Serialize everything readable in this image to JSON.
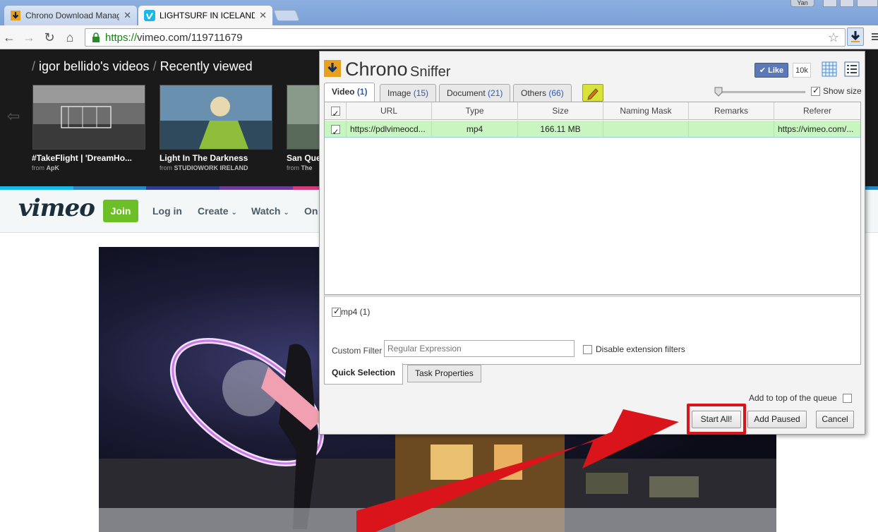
{
  "browser": {
    "tabs": [
      {
        "title": "Chrono Download Manag",
        "active": false
      },
      {
        "title": "LIGHTSURF IN ICELAND o",
        "active": true
      }
    ],
    "user_badge": "Yan",
    "address": {
      "protocol": "https://",
      "host": "vimeo.com/119711679"
    }
  },
  "vimeo": {
    "breadcrumb": {
      "owner": "igor bellido's videos",
      "section": "Recently viewed",
      "slash": "/"
    },
    "thumbnails": [
      {
        "title": "#TakeFlight | 'DreamHo...",
        "from": "from",
        "author": "ApK"
      },
      {
        "title": "Light In The Darkness",
        "from": "from",
        "author": "STUDIOWORK IRELAND"
      },
      {
        "title": "San Que",
        "from": "from",
        "author": "The"
      }
    ],
    "logo": "vimeo",
    "join": "Join",
    "nav": {
      "login": "Log in",
      "create": "Create",
      "watch": "Watch",
      "on": "On"
    }
  },
  "sniffer": {
    "title": "Chrono",
    "subtitle": "Sniffer",
    "like_label": "Like",
    "like_count": "10k",
    "show_size": "Show size",
    "tabs": [
      {
        "label": "Video",
        "count": "(1)"
      },
      {
        "label": "Image",
        "count": "(15)"
      },
      {
        "label": "Document",
        "count": "(21)"
      },
      {
        "label": "Others",
        "count": "(66)"
      }
    ],
    "columns": [
      "URL",
      "Type",
      "Size",
      "Naming Mask",
      "Remarks",
      "Referer"
    ],
    "rows": [
      {
        "url": "https://pdlvimeocd...",
        "type": "mp4",
        "size": "166.11 MB",
        "naming_mask": "",
        "remarks": "",
        "referer": "https://vimeo.com/..."
      }
    ],
    "ext_filter": "mp4 (1)",
    "custom_filter_label": "Custom Filter",
    "custom_filter_placeholder": "Regular Expression",
    "disable_ext": "Disable extension filters",
    "bottom_tabs": {
      "quick": "Quick Selection",
      "task": "Task Properties"
    },
    "add_top": "Add to top of the queue",
    "buttons": {
      "start": "Start All!",
      "paused": "Add Paused",
      "cancel": "Cancel"
    }
  },
  "colors": {
    "accent_red": "#d9141a",
    "vimeo_green": "#6cbf26",
    "row_green": "#c8f5c0"
  }
}
